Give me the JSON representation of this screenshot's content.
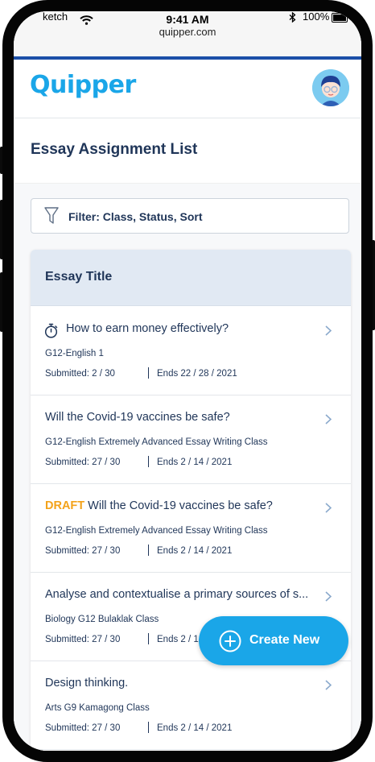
{
  "status_bar": {
    "carrier": "ketch",
    "time": "9:41 AM",
    "url": "quipper.com",
    "battery": "100%"
  },
  "header": {
    "logo": "Quipper"
  },
  "page": {
    "title": "Essay Assignment List"
  },
  "filter": {
    "label": "Filter: Class, Status, Sort"
  },
  "list": {
    "header": "Essay Title",
    "items": [
      {
        "prefix": "",
        "title": "How to earn money effectively?",
        "class": "G12-English 1",
        "submitted": "Submitted: 2  / 30",
        "ends": "Ends 22 / 28 / 2021",
        "icon": "stopwatch-icon"
      },
      {
        "prefix": "",
        "title": "Will the Covid-19 vaccines be safe?",
        "class": "G12-English Extremely Advanced Essay Writing Class",
        "submitted": "Submitted: 27  / 30",
        "ends": "Ends 2 / 14 / 2021"
      },
      {
        "prefix": "DRAFT",
        "title": "Will the Covid-19 vaccines be safe?",
        "class": "G12-English Extremely Advanced Essay Writing Class",
        "submitted": "Submitted: 27  / 30",
        "ends": "Ends 2 / 14 / 2021"
      },
      {
        "prefix": "",
        "title": "Analyse and contextualise a primary sources of s...",
        "class": "Biology G12 Bulaklak Class",
        "submitted": "Submitted: 27  / 30",
        "ends": "Ends 2 / 14 / 2021"
      },
      {
        "prefix": "",
        "title": "Design thinking.",
        "class": "Arts G9 Kamagong Class",
        "submitted": "Submitted: 27  / 30",
        "ends": "Ends 2 / 14 / 2021"
      }
    ]
  },
  "fab": {
    "label": "Create New"
  },
  "colors": {
    "brand": "#1aa6e8",
    "text": "#1f3558",
    "draft": "#f3a21a",
    "list_header_bg": "#e1e9f3"
  }
}
